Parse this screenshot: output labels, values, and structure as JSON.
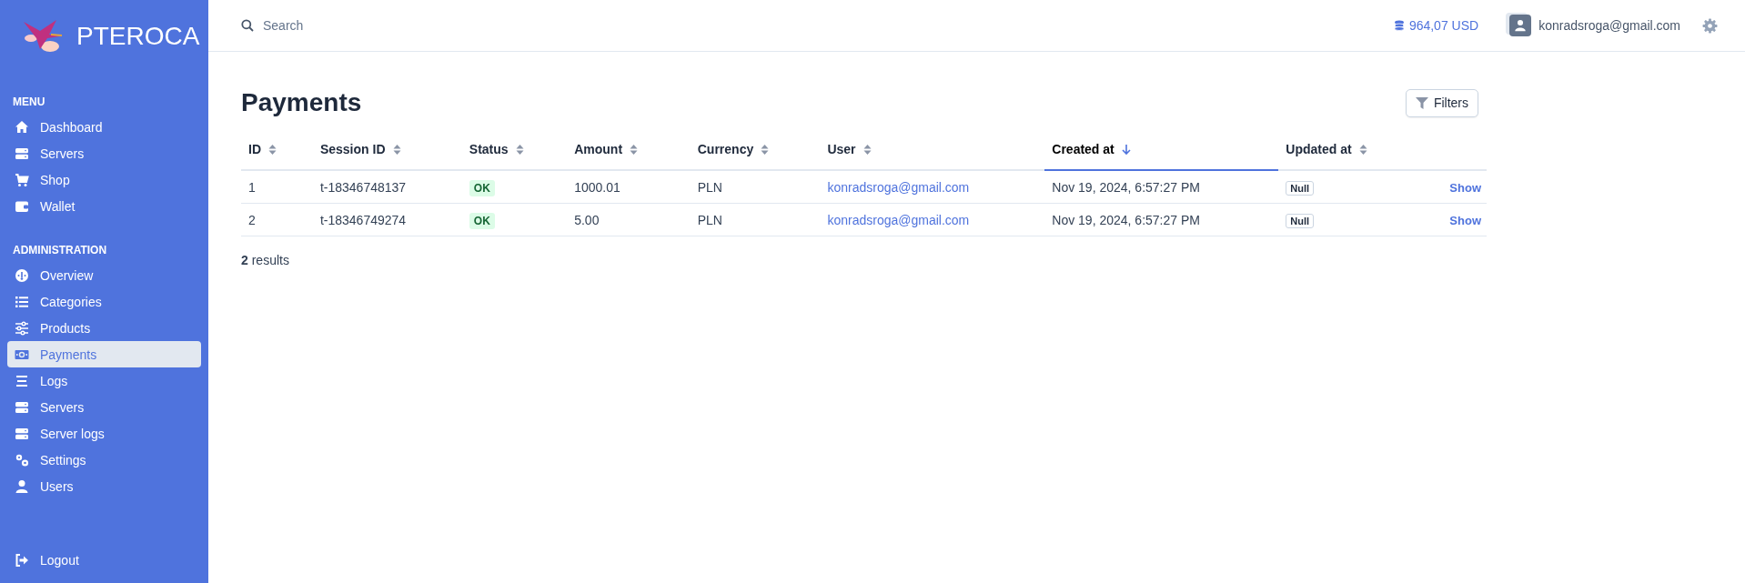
{
  "brand": {
    "name": "PTEROCA"
  },
  "sidebar": {
    "sections": [
      {
        "title": "MENU",
        "items": [
          {
            "label": "Dashboard",
            "kind": "home",
            "selected": false
          },
          {
            "label": "Servers",
            "kind": "server",
            "selected": false
          },
          {
            "label": "Shop",
            "kind": "cart",
            "selected": false
          },
          {
            "label": "Wallet",
            "kind": "wallet",
            "selected": false
          }
        ]
      },
      {
        "title": "ADMINISTRATION",
        "items": [
          {
            "label": "Overview",
            "kind": "gauge",
            "selected": false
          },
          {
            "label": "Categories",
            "kind": "list",
            "selected": false
          },
          {
            "label": "Products",
            "kind": "sliders",
            "selected": false
          },
          {
            "label": "Payments",
            "kind": "money",
            "selected": true
          },
          {
            "label": "Logs",
            "kind": "lines",
            "selected": false
          },
          {
            "label": "Servers",
            "kind": "server",
            "selected": false
          },
          {
            "label": "Server logs",
            "kind": "server",
            "selected": false
          },
          {
            "label": "Settings",
            "kind": "gears",
            "selected": false
          },
          {
            "label": "Users",
            "kind": "user",
            "selected": false
          }
        ]
      }
    ],
    "logout": {
      "label": "Logout"
    }
  },
  "header": {
    "search": {
      "placeholder": "Search"
    },
    "balance": "964,07 USD",
    "user": "konradsroga@gmail.com"
  },
  "page": {
    "title": "Payments",
    "filters_button": "Filters"
  },
  "table": {
    "columns": [
      {
        "label": "ID",
        "sorted": false
      },
      {
        "label": "Session ID",
        "sorted": false
      },
      {
        "label": "Status",
        "sorted": false
      },
      {
        "label": "Amount",
        "sorted": false
      },
      {
        "label": "Currency",
        "sorted": false
      },
      {
        "label": "User",
        "sorted": false
      },
      {
        "label": "Created at",
        "sorted": true
      },
      {
        "label": "Updated at",
        "sorted": false
      }
    ],
    "rows": [
      {
        "id": "1",
        "session_id": "t-18346748137",
        "status": "OK",
        "amount": "1000.01",
        "currency": "PLN",
        "user": "konradsroga@gmail.com",
        "created_at": "Nov 19, 2024, 6:57:27 PM",
        "updated_at": "Null",
        "action": "Show"
      },
      {
        "id": "2",
        "session_id": "t-18346749274",
        "status": "OK",
        "amount": "5.00",
        "currency": "PLN",
        "user": "konradsroga@gmail.com",
        "created_at": "Nov 19, 2024, 6:57:27 PM",
        "updated_at": "Null",
        "action": "Show"
      }
    ]
  },
  "results": {
    "count": "2",
    "label": "results"
  }
}
